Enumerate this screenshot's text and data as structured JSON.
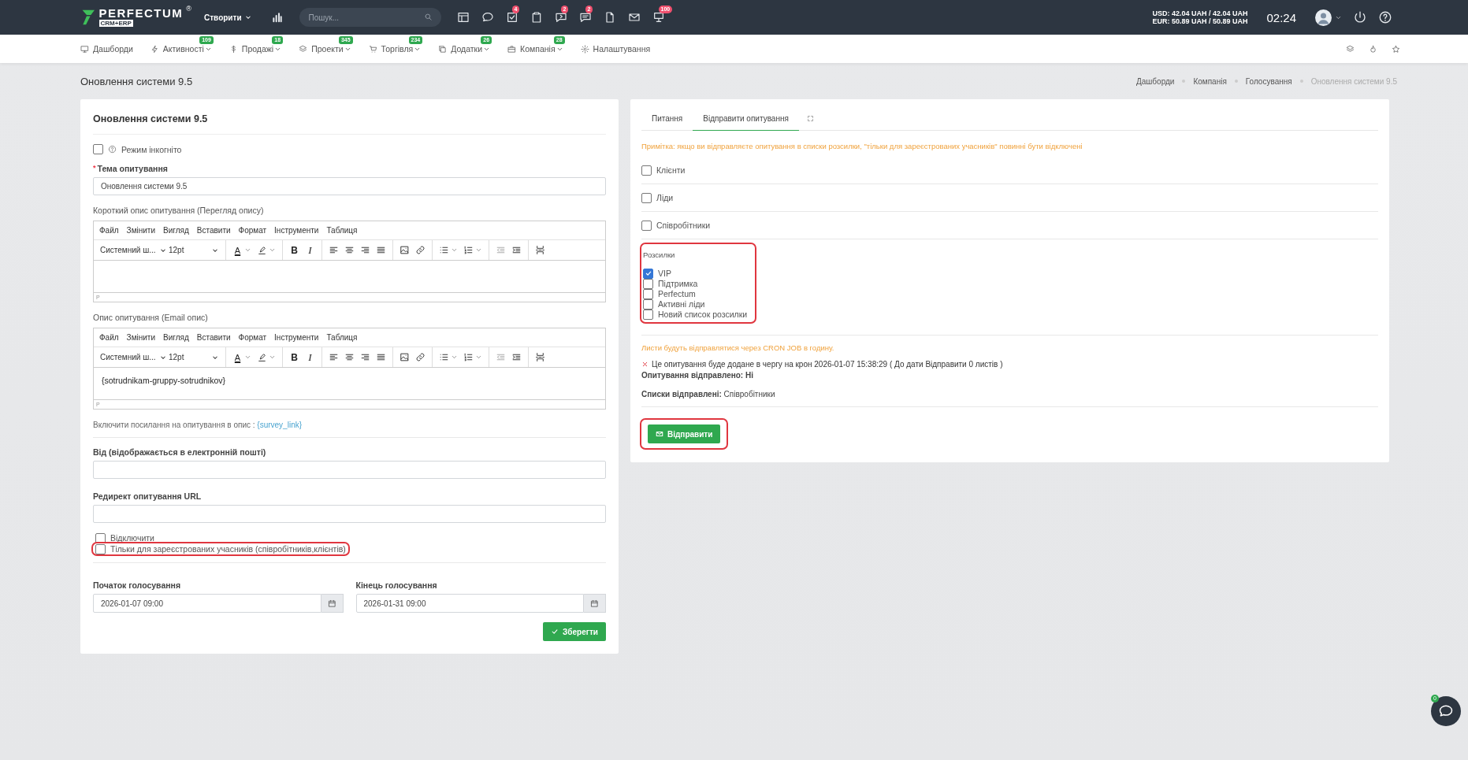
{
  "topbar": {
    "logo": {
      "name": "PERFECTUM",
      "mark": "®",
      "sub": "CRM+ERP"
    },
    "create": "Створити",
    "search": {
      "placeholder": "Пошук..."
    },
    "icons": [
      {
        "kind": "layout"
      },
      {
        "kind": "chat"
      },
      {
        "kind": "checksquare",
        "badge": "4"
      },
      {
        "kind": "clipboard"
      },
      {
        "kind": "message",
        "badge": "2"
      },
      {
        "kind": "chatlist",
        "badge": "2"
      },
      {
        "kind": "document"
      },
      {
        "kind": "mail"
      },
      {
        "kind": "board",
        "badge": "100"
      }
    ],
    "currency": [
      "USD: 42.04 UAH / 42.04 UAH",
      "EUR: 50.89 UAH / 50.89 UAH"
    ],
    "time": "02:24"
  },
  "nav": [
    {
      "kind": "monitor",
      "label": "Дашборди"
    },
    {
      "kind": "bolt",
      "label": "Активності",
      "badge": "109"
    },
    {
      "kind": "dollar",
      "label": "Продажі",
      "badge": "18"
    },
    {
      "kind": "layers",
      "label": "Проекти",
      "badge": "345"
    },
    {
      "kind": "cart",
      "label": "Торгівля",
      "badge": "234"
    },
    {
      "kind": "copy",
      "label": "Додатки",
      "badge": "26"
    },
    {
      "kind": "briefcase",
      "label": "Компанія",
      "badge": "28"
    },
    {
      "kind": "gear",
      "label": "Налаштування"
    }
  ],
  "page_title": "Оновлення системи 9.5",
  "breadcrumbs": [
    {
      "label": "Дашборди",
      "current": false
    },
    {
      "label": "Компанія",
      "current": false
    },
    {
      "label": "Голосування",
      "current": false
    },
    {
      "label": "Оновлення системи 9.5",
      "current": true
    }
  ],
  "form": {
    "title": "Оновлення системи 9.5",
    "incognito": {
      "label": "Режим інкогніто",
      "checked": false
    },
    "subject": {
      "label": "Тема опитування",
      "required_mark": "*",
      "value": "Оновлення системи 9.5"
    },
    "editors": [
      {
        "label": "Короткий опис опитування (Перегляд опису)",
        "menu": [
          "Файл",
          "Змінити",
          "Вигляд",
          "Вставити",
          "Формат",
          "Інструменти",
          "Таблиця"
        ],
        "font": "Системний ш...",
        "size": "12pt",
        "tools": [
          [
            {
              "kind": "forecolor",
              "glyph": "A",
              "split": true
            },
            {
              "kind": "backcolor",
              "split": true
            }
          ],
          [
            {
              "kind": "bold",
              "glyph": "B"
            },
            {
              "kind": "italic",
              "glyph": "I"
            }
          ],
          [
            {
              "kind": "alignleft"
            },
            {
              "kind": "aligncenter"
            },
            {
              "kind": "alignright"
            },
            {
              "kind": "justify"
            }
          ],
          [
            {
              "kind": "image"
            },
            {
              "kind": "link"
            }
          ],
          [
            {
              "kind": "bullist",
              "split": true
            },
            {
              "kind": "numlist",
              "split": true
            }
          ],
          [
            {
              "kind": "outdent",
              "disabled": true
            },
            {
              "kind": "indent"
            }
          ],
          [
            {
              "kind": "pagebreak"
            }
          ]
        ],
        "status": "P"
      },
      {
        "label": "Опис опитування (Email опис)",
        "menu": [
          "Файл",
          "Змінити",
          "Вигляд",
          "Вставити",
          "Формат",
          "Інструменти",
          "Таблиця"
        ],
        "font": "Системний ш...",
        "size": "12pt",
        "tools": [
          [
            {
              "kind": "forecolor",
              "glyph": "A",
              "split": true
            },
            {
              "kind": "backcolor",
              "split": true
            }
          ],
          [
            {
              "kind": "bold",
              "glyph": "B"
            },
            {
              "kind": "italic",
              "glyph": "I"
            }
          ],
          [
            {
              "kind": "alignleft"
            },
            {
              "kind": "aligncenter"
            },
            {
              "kind": "alignright"
            },
            {
              "kind": "justify"
            }
          ],
          [
            {
              "kind": "image"
            },
            {
              "kind": "link"
            }
          ],
          [
            {
              "kind": "bullist",
              "split": true
            },
            {
              "kind": "numlist",
              "split": true
            }
          ],
          [
            {
              "kind": "outdent",
              "disabled": true
            },
            {
              "kind": "indent"
            }
          ],
          [
            {
              "kind": "pagebreak"
            }
          ]
        ],
        "content": "{sotrudnikam-gruppy-sotrudnikov}",
        "status": "P"
      }
    ],
    "link_note": {
      "text": "Включити посилання на опитування в опис :",
      "link": "{survey_link}"
    },
    "from": {
      "label": "Від (відображається в електронній пошті)"
    },
    "redirect": {
      "label": "Редирект опитування URL"
    },
    "options": [
      {
        "label": "Відключити",
        "checked": false,
        "highlighted": false
      },
      {
        "label": "Тільки для зареєстрованих учасників (співробітників,клієнтів)",
        "checked": false,
        "highlighted": true
      }
    ],
    "dates": [
      {
        "label": "Початок голосування",
        "value": "2026-01-07 09:00"
      },
      {
        "label": "Кінець голосування",
        "value": "2026-01-31 09:00"
      }
    ],
    "save": "Зберегти"
  },
  "send": {
    "tabs": [
      {
        "label": "Питання",
        "selected": false
      },
      {
        "label": "Відправити опитування",
        "selected": true
      }
    ],
    "note": "Примітка: якщо ви відправляєте опитування в списки розсилки, \"тільки для зареєстрованих учасників\" повинні бути відключені",
    "groups": [
      {
        "label": "Клієнти",
        "checked": false
      },
      {
        "label": "Ліди",
        "checked": false
      },
      {
        "label": "Співробітники",
        "checked": false
      }
    ],
    "mailing": {
      "title": "Розсилки",
      "highlighted": true,
      "lists": [
        {
          "label": "VIP",
          "checked": true
        },
        {
          "label": "Підтримка",
          "checked": false
        },
        {
          "label": "Perfectum",
          "checked": false
        },
        {
          "label": "Активні ліди",
          "checked": false
        },
        {
          "label": "Новий список розсилки",
          "checked": false
        }
      ]
    },
    "cron_note": "Листи будуть відправлятися через CRON JOB в годину.",
    "queue": "Це опитування буде додане в чергу на крон 2026-01-07 15:38:29 ( До дати Відправити 0 листів )",
    "sent": "Опитування відправлено: Ні",
    "lists_sent": "**Списки відправлені:** Співробітники",
    "button": {
      "label": "Відправити",
      "highlighted": true
    }
  },
  "chat": {
    "badge": "0"
  }
}
